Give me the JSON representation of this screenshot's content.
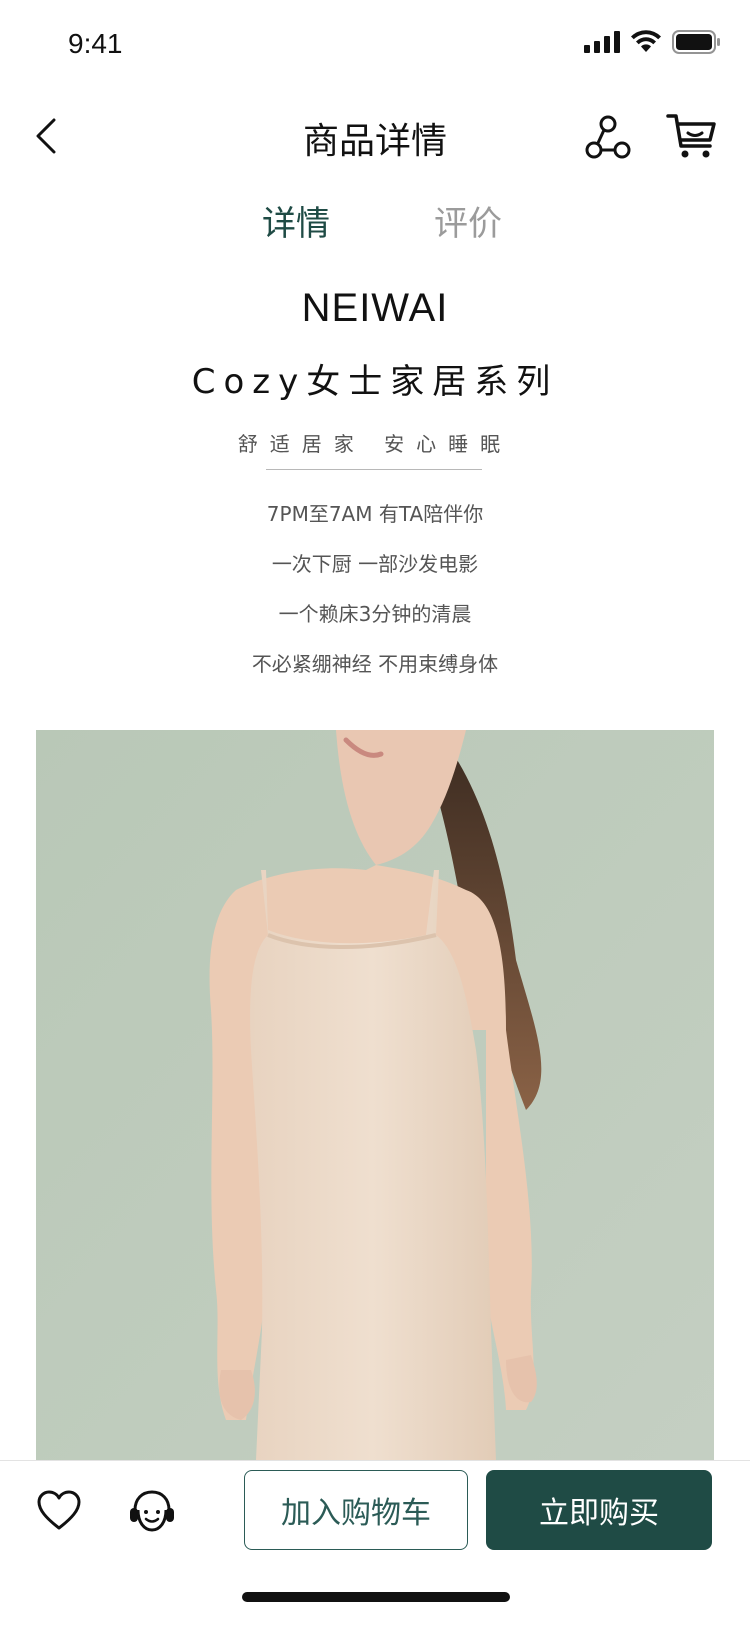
{
  "status_bar": {
    "time": "9:41"
  },
  "nav": {
    "title": "商品详情"
  },
  "tabs": [
    {
      "label": "详情",
      "active": true
    },
    {
      "label": "评价",
      "active": false
    }
  ],
  "intro": {
    "brand": "NEIWAI",
    "series": "Cozy女士家居系列",
    "slogan": "舒适居家  安心睡眠",
    "lines": [
      "7PM至7AM 有TA陪伴你",
      "一次下厨  一部沙发电影",
      "一个赖床3分钟的清晨",
      "不必紧绷神经  不用束缚身体"
    ]
  },
  "bottom_bar": {
    "add_to_cart_label": "加入购物车",
    "buy_now_label": "立即购买"
  },
  "colors": {
    "accent": "#1f4b45",
    "tab_inactive": "#9b9b9b",
    "hero_bg": "#bccab9"
  },
  "icons": {
    "back": "chevron-left-icon",
    "share": "share-icon",
    "cart": "cart-icon",
    "favorite": "heart-icon",
    "service": "customer-service-icon"
  }
}
